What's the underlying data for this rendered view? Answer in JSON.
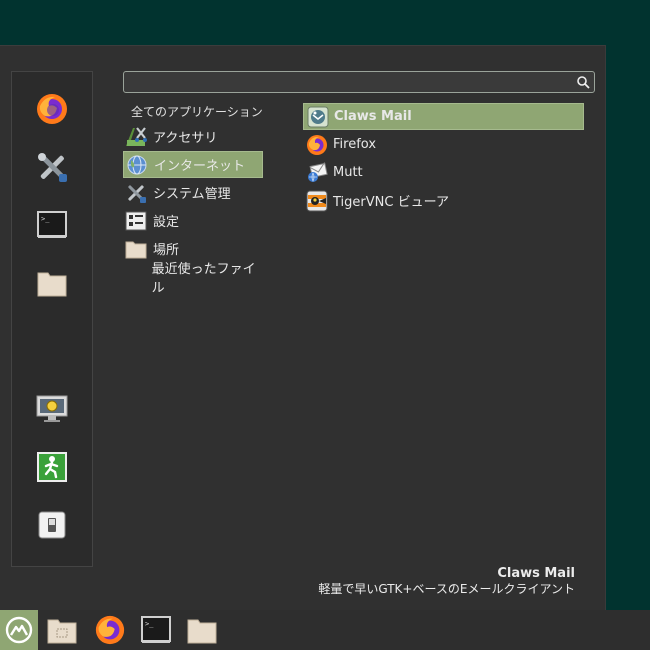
{
  "search": {
    "placeholder": "",
    "value": ""
  },
  "favorites": [
    {
      "name": "firefox-icon"
    },
    {
      "name": "tools-icon"
    },
    {
      "name": "terminal-icon"
    },
    {
      "name": "folder-icon"
    },
    {
      "name": "lock-screen-icon"
    },
    {
      "name": "logout-icon"
    },
    {
      "name": "power-icon"
    }
  ],
  "categories": {
    "header": "全てのアプリケーション",
    "items": [
      {
        "label": "アクセサリ",
        "icon": "accessories-icon",
        "selected": false
      },
      {
        "label": "インターネット",
        "icon": "globe-icon",
        "selected": true
      },
      {
        "label": "システム管理",
        "icon": "tools-icon",
        "selected": false
      },
      {
        "label": "設定",
        "icon": "settings-icon",
        "selected": false
      },
      {
        "label": "場所",
        "icon": "folder-icon",
        "selected": false
      },
      {
        "label": "最近使ったファイル",
        "icon": "",
        "selected": false
      }
    ]
  },
  "apps": [
    {
      "label": "Claws Mail",
      "icon": "claws-mail-icon",
      "selected": true
    },
    {
      "label": "Firefox",
      "icon": "firefox-icon",
      "selected": false
    },
    {
      "label": "Mutt",
      "icon": "mail-icon",
      "selected": false
    },
    {
      "label": "TigerVNC ビューア",
      "icon": "vnc-icon",
      "selected": false
    }
  ],
  "description": {
    "title": "Claws Mail",
    "text": "軽量で早いGTK+ベースのEメールクライアント"
  },
  "colors": {
    "accent": "#8fa673",
    "desktop": "#01332f",
    "menu_bg": "#303030"
  }
}
